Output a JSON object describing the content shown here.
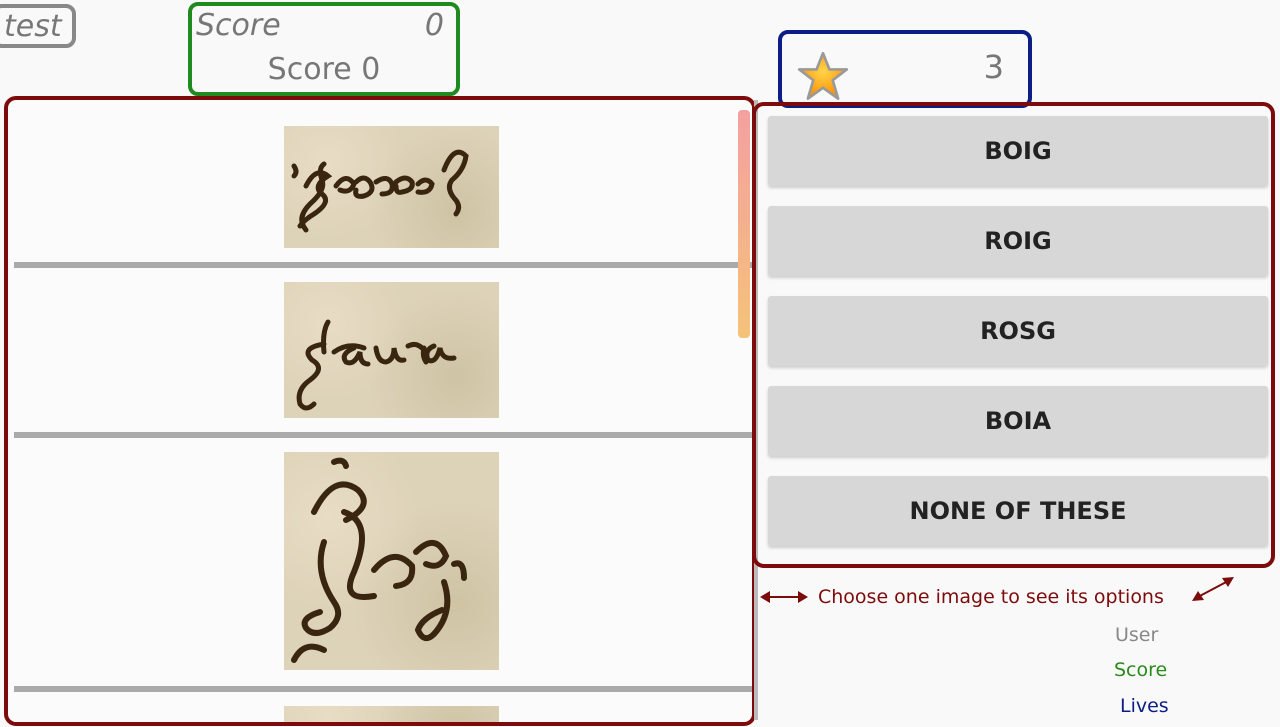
{
  "user_box": {
    "label": "test"
  },
  "score_box": {
    "label": "Score",
    "value": "0",
    "text": "Score 0"
  },
  "lives_box": {
    "icon": "star-icon",
    "value": "3"
  },
  "options": [
    {
      "label": "BOIG"
    },
    {
      "label": "ROIG"
    },
    {
      "label": "ROSG"
    },
    {
      "label": "BOIA"
    },
    {
      "label": "NONE OF THESE"
    }
  ],
  "hint": {
    "text": "Choose one image to see its options"
  },
  "legend": {
    "user": "User",
    "score": "Score",
    "lives": "Lives"
  },
  "colors": {
    "panel_border": "#7e0b0b",
    "score_border": "#1f8a1f",
    "lives_border": "#0c1e86",
    "user_border": "#888888",
    "option_bg": "#d6d7d6",
    "legend_user": "#888888",
    "legend_score": "#2a8a1a",
    "legend_lives": "#0c1e86"
  }
}
